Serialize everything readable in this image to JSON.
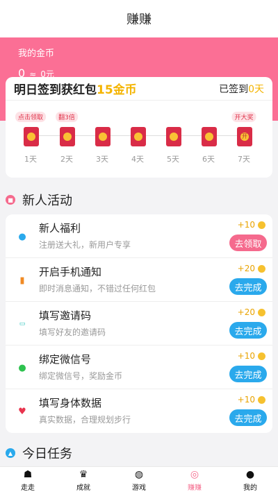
{
  "header": {
    "title": "赚赚"
  },
  "coins": {
    "label": "我的金币",
    "amount": "0",
    "approx": "≈",
    "money": "0元"
  },
  "signin": {
    "title_prefix": "明日签到获红包",
    "title_highlight": "15金币",
    "signed_prefix": "已签到",
    "signed_days": "0天",
    "days": [
      {
        "label": "1天",
        "tag": "点击领取"
      },
      {
        "label": "2天",
        "tag": "翻3倍"
      },
      {
        "label": "3天",
        "tag": ""
      },
      {
        "label": "4天",
        "tag": ""
      },
      {
        "label": "5天",
        "tag": ""
      },
      {
        "label": "6天",
        "tag": ""
      },
      {
        "label": "7天",
        "tag": "开大奖"
      }
    ]
  },
  "newbie": {
    "title": "新人活动",
    "tasks": [
      {
        "name": "新人福利",
        "desc": "注册送大礼，新用户专享",
        "reward": "+10",
        "button": "去领取",
        "icon": "user-icon"
      },
      {
        "name": "开启手机通知",
        "desc": "即时消息通知，不错过任何红包",
        "reward": "+20",
        "button": "去完成",
        "icon": "phone-icon"
      },
      {
        "name": "填写邀请码",
        "desc": "填写好友的邀请码",
        "reward": "+20",
        "button": "去完成",
        "icon": "id-icon"
      },
      {
        "name": "绑定微信号",
        "desc": "绑定微信号，奖励金币",
        "reward": "+10",
        "button": "去完成",
        "icon": "wechat-icon"
      },
      {
        "name": "填写身体数据",
        "desc": "真实数据，合理规划步行",
        "reward": "+10",
        "button": "去完成",
        "icon": "heart-icon"
      }
    ]
  },
  "today": {
    "title": "今日任务"
  },
  "tabs": [
    {
      "label": "走走",
      "icon": "walk-icon"
    },
    {
      "label": "成就",
      "icon": "trophy-icon"
    },
    {
      "label": "游戏",
      "icon": "gamepad-icon"
    },
    {
      "label": "赚赚",
      "icon": "earn-icon"
    },
    {
      "label": "我的",
      "icon": "person-icon"
    }
  ],
  "colors": {
    "pink": "#fb6f95",
    "gold": "#f4b400",
    "blue": "#2aa9ec"
  }
}
